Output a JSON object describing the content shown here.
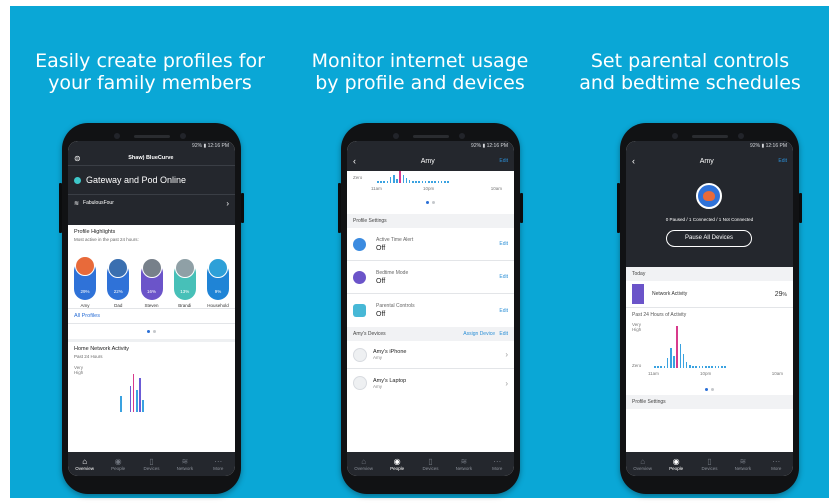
{
  "captions": [
    {
      "line1": "Easily create profiles for",
      "line2": "your family members"
    },
    {
      "line1": "Monitor internet usage",
      "line2": "by profile and devices"
    },
    {
      "line1": "Set parental controls",
      "line2": "and bedtime schedules"
    }
  ],
  "status_bar": {
    "text": "92% ▮ 12:16 PM"
  },
  "tabbar": {
    "items": [
      "Overview",
      "People",
      "Devices",
      "Network",
      "More"
    ]
  },
  "phone1": {
    "brand": "Shaw) BlueCurve",
    "gateway_status": "Gateway and Pod Online",
    "network_name": "FabulousFour",
    "highlights_title": "Profile Highlights",
    "highlights_sub": "Most active in the past 24 hours:",
    "profiles": [
      {
        "name": "Amy",
        "pct": "29%",
        "color": "#2f72d8",
        "face": "#e86a3a"
      },
      {
        "name": "Dad",
        "pct": "22%",
        "color": "#2f72d8",
        "face": "#3a6fb0"
      },
      {
        "name": "Steven",
        "pct": "16%",
        "color": "#6b54c9",
        "face": "#77808a"
      },
      {
        "name": "Brandi",
        "pct": "13%",
        "color": "#47c0b8",
        "face": "#8fa0a6"
      },
      {
        "name": "Household",
        "pct": "9%",
        "color": "#1f84d6",
        "face": "#2da0d8"
      }
    ],
    "all_profiles": "All Profiles",
    "activity_title": "Home Network Activity",
    "activity_sub": "Past 24 Hours",
    "axis_top": "Very High"
  },
  "phone2": {
    "title": "Amy",
    "edit": "Edit",
    "axis_zero": "Zero",
    "ticks": [
      "11am",
      "10pm",
      "10am"
    ],
    "settings_title": "Profile Settings",
    "settings": [
      {
        "label": "Active Time Alert",
        "value": "Off",
        "edit": "Edit",
        "color": "#3b8be0"
      },
      {
        "label": "Bedtime Mode",
        "value": "Off",
        "edit": "Edit",
        "color": "#6b54c9"
      },
      {
        "label": "Parental Controls",
        "value": "Off",
        "edit": "Edit",
        "color": "#47b8d6"
      }
    ],
    "devices_title": "Amy's Devices",
    "assign": "Assign Device",
    "devices_edit": "Edit",
    "devices": [
      {
        "name": "Amy's iPhone",
        "owner": "Amy"
      },
      {
        "name": "Amy's Laptop",
        "owner": "Amy"
      }
    ]
  },
  "phone3": {
    "title": "Amy",
    "edit": "Edit",
    "counts": "0 Paused / 1 Connected / 1 Not Connected",
    "pause_button": "Pause All Devices",
    "today": "Today",
    "network_activity": "Network Activity",
    "network_pct": "29",
    "pct_sign": "%",
    "past_label": "Past 24 Hours of Activity",
    "axis_top": "Very High",
    "axis_zero": "Zero",
    "ticks": [
      "11am",
      "10pm",
      "10am"
    ],
    "profile_settings": "Profile Settings"
  }
}
